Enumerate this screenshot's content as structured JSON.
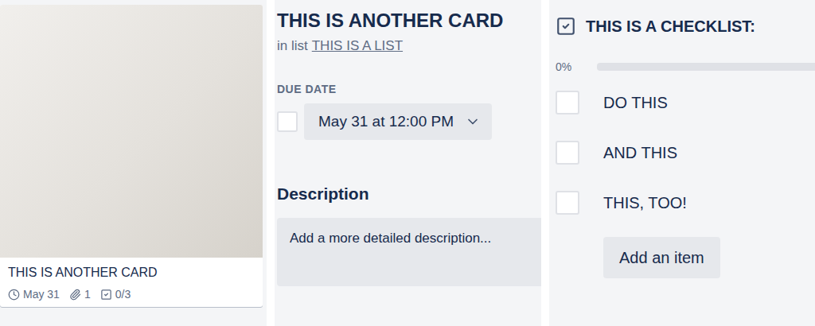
{
  "card": {
    "title": "THIS IS ANOTHER CARD",
    "badges": [
      {
        "kind": "due",
        "text": "May 31"
      },
      {
        "kind": "attachments",
        "text": "1"
      },
      {
        "kind": "checklist",
        "text": "0/3"
      }
    ]
  },
  "detail": {
    "title": "THIS IS ANOTHER CARD",
    "list_prefix": "in list",
    "list_name": "THIS IS A LIST",
    "due_label": "DUE DATE",
    "due": {
      "text": "May 31 at 12:00 PM",
      "checked": false
    },
    "description_label": "Description",
    "description_placeholder": "Add a more detailed description..."
  },
  "checklist": {
    "title": "THIS IS A CHECKLIST:",
    "percent": "0%",
    "level": 0,
    "items": [
      {
        "text": "DO THIS",
        "checked": false
      },
      {
        "text": "AND THIS",
        "checked": false
      },
      {
        "text": "THIS, TOO!",
        "checked": false
      }
    ],
    "add_button": "Add an item"
  }
}
